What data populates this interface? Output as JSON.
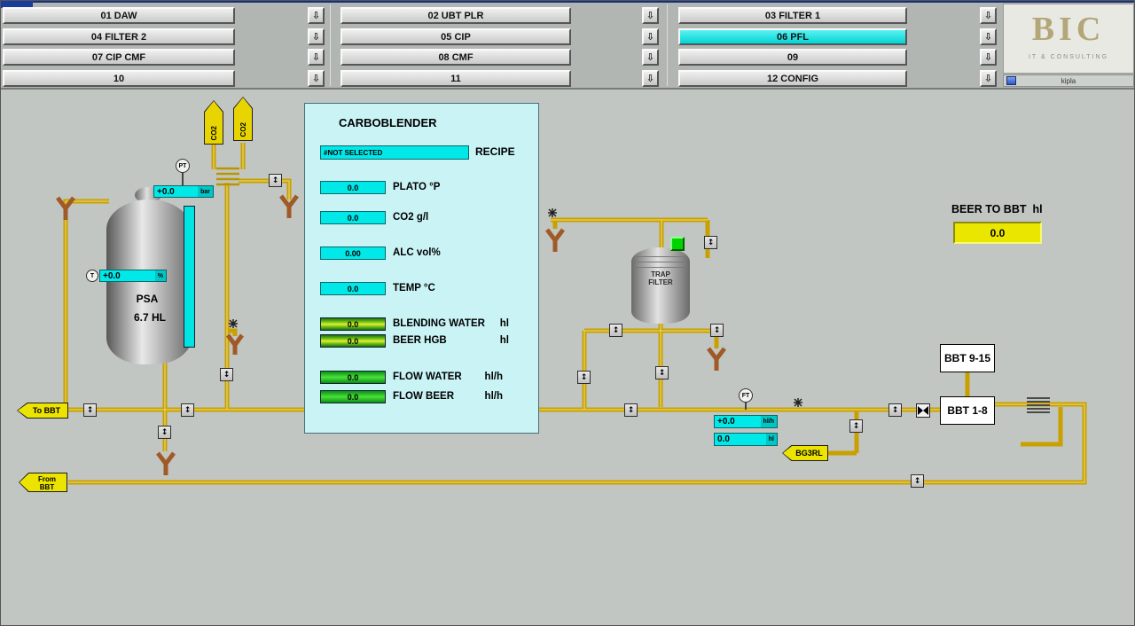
{
  "nav": {
    "items": [
      {
        "label": "01 DAW",
        "active": false
      },
      {
        "label": "02 UBT PLR",
        "active": false
      },
      {
        "label": "03 FILTER 1",
        "active": false
      },
      {
        "label": "04 FILTER 2",
        "active": false
      },
      {
        "label": "05 CIP",
        "active": false
      },
      {
        "label": "06 PFL",
        "active": true
      },
      {
        "label": "07 CIP CMF",
        "active": false
      },
      {
        "label": "08 CMF",
        "active": false
      },
      {
        "label": "09",
        "active": false
      },
      {
        "label": "10",
        "active": false
      },
      {
        "label": "11",
        "active": false
      },
      {
        "label": "12 CONFIG",
        "active": false
      }
    ]
  },
  "branding": {
    "logo": "BIC",
    "tagline": "IT & CONSULTING",
    "status": "kipla"
  },
  "panel": {
    "title": "CARBOBLENDER",
    "recipe_value": "#NOT SELECTED",
    "recipe_label": "RECIPE",
    "fields": [
      {
        "value": "0.0",
        "label": "PLATO °P",
        "unit": ""
      },
      {
        "value": "0.0",
        "label": "CO2 g/l",
        "unit": ""
      },
      {
        "value": "0.00",
        "label": "ALC vol%",
        "unit": ""
      },
      {
        "value": "0.0",
        "label": "TEMP °C",
        "unit": ""
      },
      {
        "value": "0.0",
        "label": "BLENDING WATER",
        "unit": "hl"
      },
      {
        "value": "0.0",
        "label": "BEER HGB",
        "unit": "hl"
      },
      {
        "value": "0.0",
        "label": "FLOW  WATER",
        "unit": "hl/h"
      },
      {
        "value": "0.0",
        "label": "FLOW  BEER",
        "unit": "hl/h"
      }
    ]
  },
  "tank": {
    "name": "PSA",
    "capacity": "6.7 HL",
    "pressure_value": "+0.0",
    "pressure_unit": "bar",
    "level_value": "+0.0",
    "level_unit": "%",
    "pt_sensor": "PT",
    "t_sensor": "T"
  },
  "trap_filter": {
    "line1": "TRAP",
    "line2": "FILTER"
  },
  "beer_to_bbt": {
    "label": "BEER TO BBT",
    "unit": "hl",
    "value": "0.0"
  },
  "bbt": {
    "upper": "BBT 9-15",
    "lower": "BBT 1-8"
  },
  "flow_meter": {
    "sensor": "FT",
    "rate_value": "+0.0",
    "rate_unit": "hl/h",
    "total_value": "0.0",
    "total_unit": "hl"
  },
  "tags": {
    "to_bbt": "To BBT",
    "from_line1": "From",
    "from_line2": "BBT",
    "bg3rl": "BG3RL"
  },
  "co2_label": "CO2",
  "icons": {
    "updown": "↕",
    "down_arrow": "⇩"
  },
  "colors": {
    "active_button": "#00d4d4",
    "pipe": "#c8a000",
    "valve": "#a05a28",
    "cyan_field": "#00e8e8",
    "yellow_display": "#ebe600"
  }
}
